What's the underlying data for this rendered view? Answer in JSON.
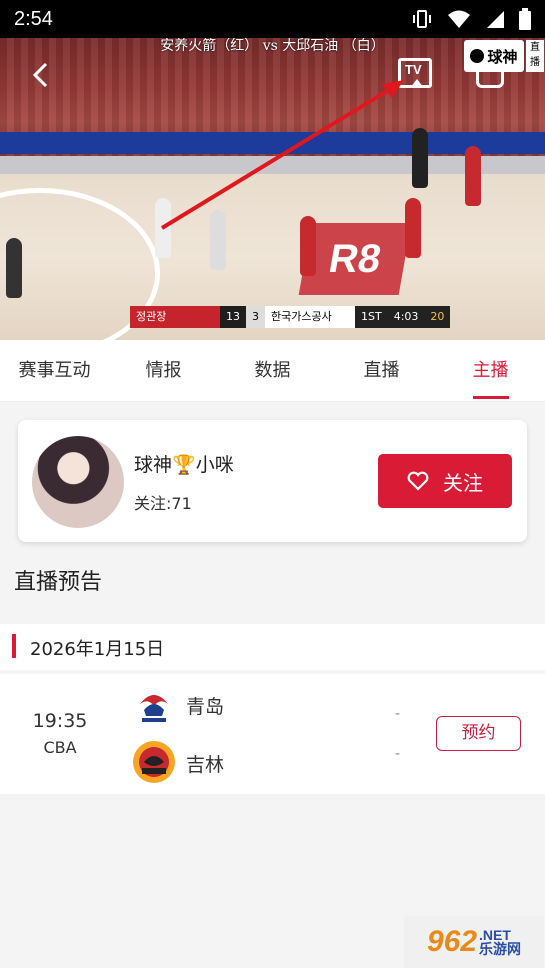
{
  "status_bar": {
    "time": "2:54"
  },
  "video": {
    "title": "安养火箭（红） vs 大邱石油 （白）",
    "brand_logo": "球神",
    "live_badge": "直播",
    "center_court_text": "R8",
    "scoreboard": {
      "team1": "정관장",
      "score1": "13",
      "score2": "3",
      "team2": "한국가스공사",
      "period": "1ST",
      "clock": "4:03",
      "shot_clock": "20"
    }
  },
  "tabs": [
    {
      "label": "赛事互动"
    },
    {
      "label": "情报"
    },
    {
      "label": "数据"
    },
    {
      "label": "直播"
    },
    {
      "label": "主播",
      "active": true
    }
  ],
  "anchor": {
    "name_prefix": "球神",
    "name_icon": "trophy-icon",
    "name_suffix": "小咪",
    "followers": "关注:71",
    "follow_label": "关注"
  },
  "schedule": {
    "title": "直播预告",
    "date": "2026年1月15日",
    "matches": [
      {
        "time": "19:35",
        "league": "CBA",
        "home": {
          "name": "青岛",
          "score": "-"
        },
        "away": {
          "name": "吉林",
          "score": "-"
        },
        "action_label": "预约"
      }
    ]
  },
  "watermark": {
    "num": "962",
    "net": ".NET",
    "sub": "乐游网"
  },
  "colors": {
    "accent": "#d91b35"
  }
}
